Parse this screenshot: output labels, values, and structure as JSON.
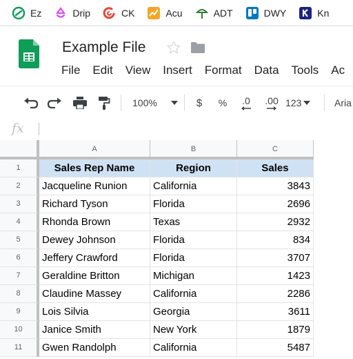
{
  "bookmarks": [
    {
      "label": "Ez",
      "icon": "ez-logo-icon",
      "color": "#0f9d58"
    },
    {
      "label": "Drip",
      "icon": "drip-logo-icon",
      "color": "#e040fb"
    },
    {
      "label": "CK",
      "icon": "ck-logo-icon",
      "color": "#ea4335"
    },
    {
      "label": "Acu",
      "icon": "acu-logo-icon",
      "color": "#f4a623"
    },
    {
      "label": "ADT",
      "icon": "adt-tree-icon",
      "color": "#2e7d32"
    },
    {
      "label": "DWY",
      "icon": "trello-icon",
      "color": "#0079bf"
    },
    {
      "label": "Kn",
      "icon": "k-logo-icon",
      "color": "#1a237e"
    }
  ],
  "doc": {
    "title": "Example File",
    "menu": [
      "File",
      "Edit",
      "View",
      "Insert",
      "Format",
      "Data",
      "Tools",
      "Ac"
    ]
  },
  "toolbar": {
    "zoom": "100%",
    "currency": "$",
    "percent": "%",
    "decrease_decimal": ".0",
    "increase_decimal": ".00",
    "more_formats": "123",
    "font": "Aria"
  },
  "formula_bar": {
    "fx_label": "fx",
    "value": ""
  },
  "sheet": {
    "columns": [
      "A",
      "B",
      "C"
    ],
    "header": {
      "name": "Sales Rep Name",
      "region": "Region",
      "sales": "Sales"
    },
    "rows": [
      {
        "n": "1"
      },
      {
        "n": "2",
        "name": "Jacqueline Runion",
        "region": "California",
        "sales": "3843"
      },
      {
        "n": "3",
        "name": "Richard Tyson",
        "region": "Florida",
        "sales": "2696"
      },
      {
        "n": "4",
        "name": "Rhonda Brown",
        "region": "Texas",
        "sales": "2932"
      },
      {
        "n": "5",
        "name": "Dewey Johnson",
        "region": "Florida",
        "sales": "834"
      },
      {
        "n": "6",
        "name": "Jeffery Crawford",
        "region": "Florida",
        "sales": "3707"
      },
      {
        "n": "7",
        "name": "Geraldine Britton",
        "region": "Michigan",
        "sales": "1423"
      },
      {
        "n": "8",
        "name": "Claudine Massey",
        "region": "California",
        "sales": "2286"
      },
      {
        "n": "9",
        "name": "Lois Silvia",
        "region": "Georgia",
        "sales": "3611"
      },
      {
        "n": "10",
        "name": "Janice Smith",
        "region": "New York",
        "sales": "1879"
      },
      {
        "n": "11",
        "name": "Gwen Randolph",
        "region": "California",
        "sales": "5487"
      }
    ]
  },
  "colors": {
    "sheets_green": "#0f9d58",
    "header_fill": "#cfe2f3",
    "gridline": "#e2e3e3",
    "frozen_line": "#c0c0c0"
  }
}
